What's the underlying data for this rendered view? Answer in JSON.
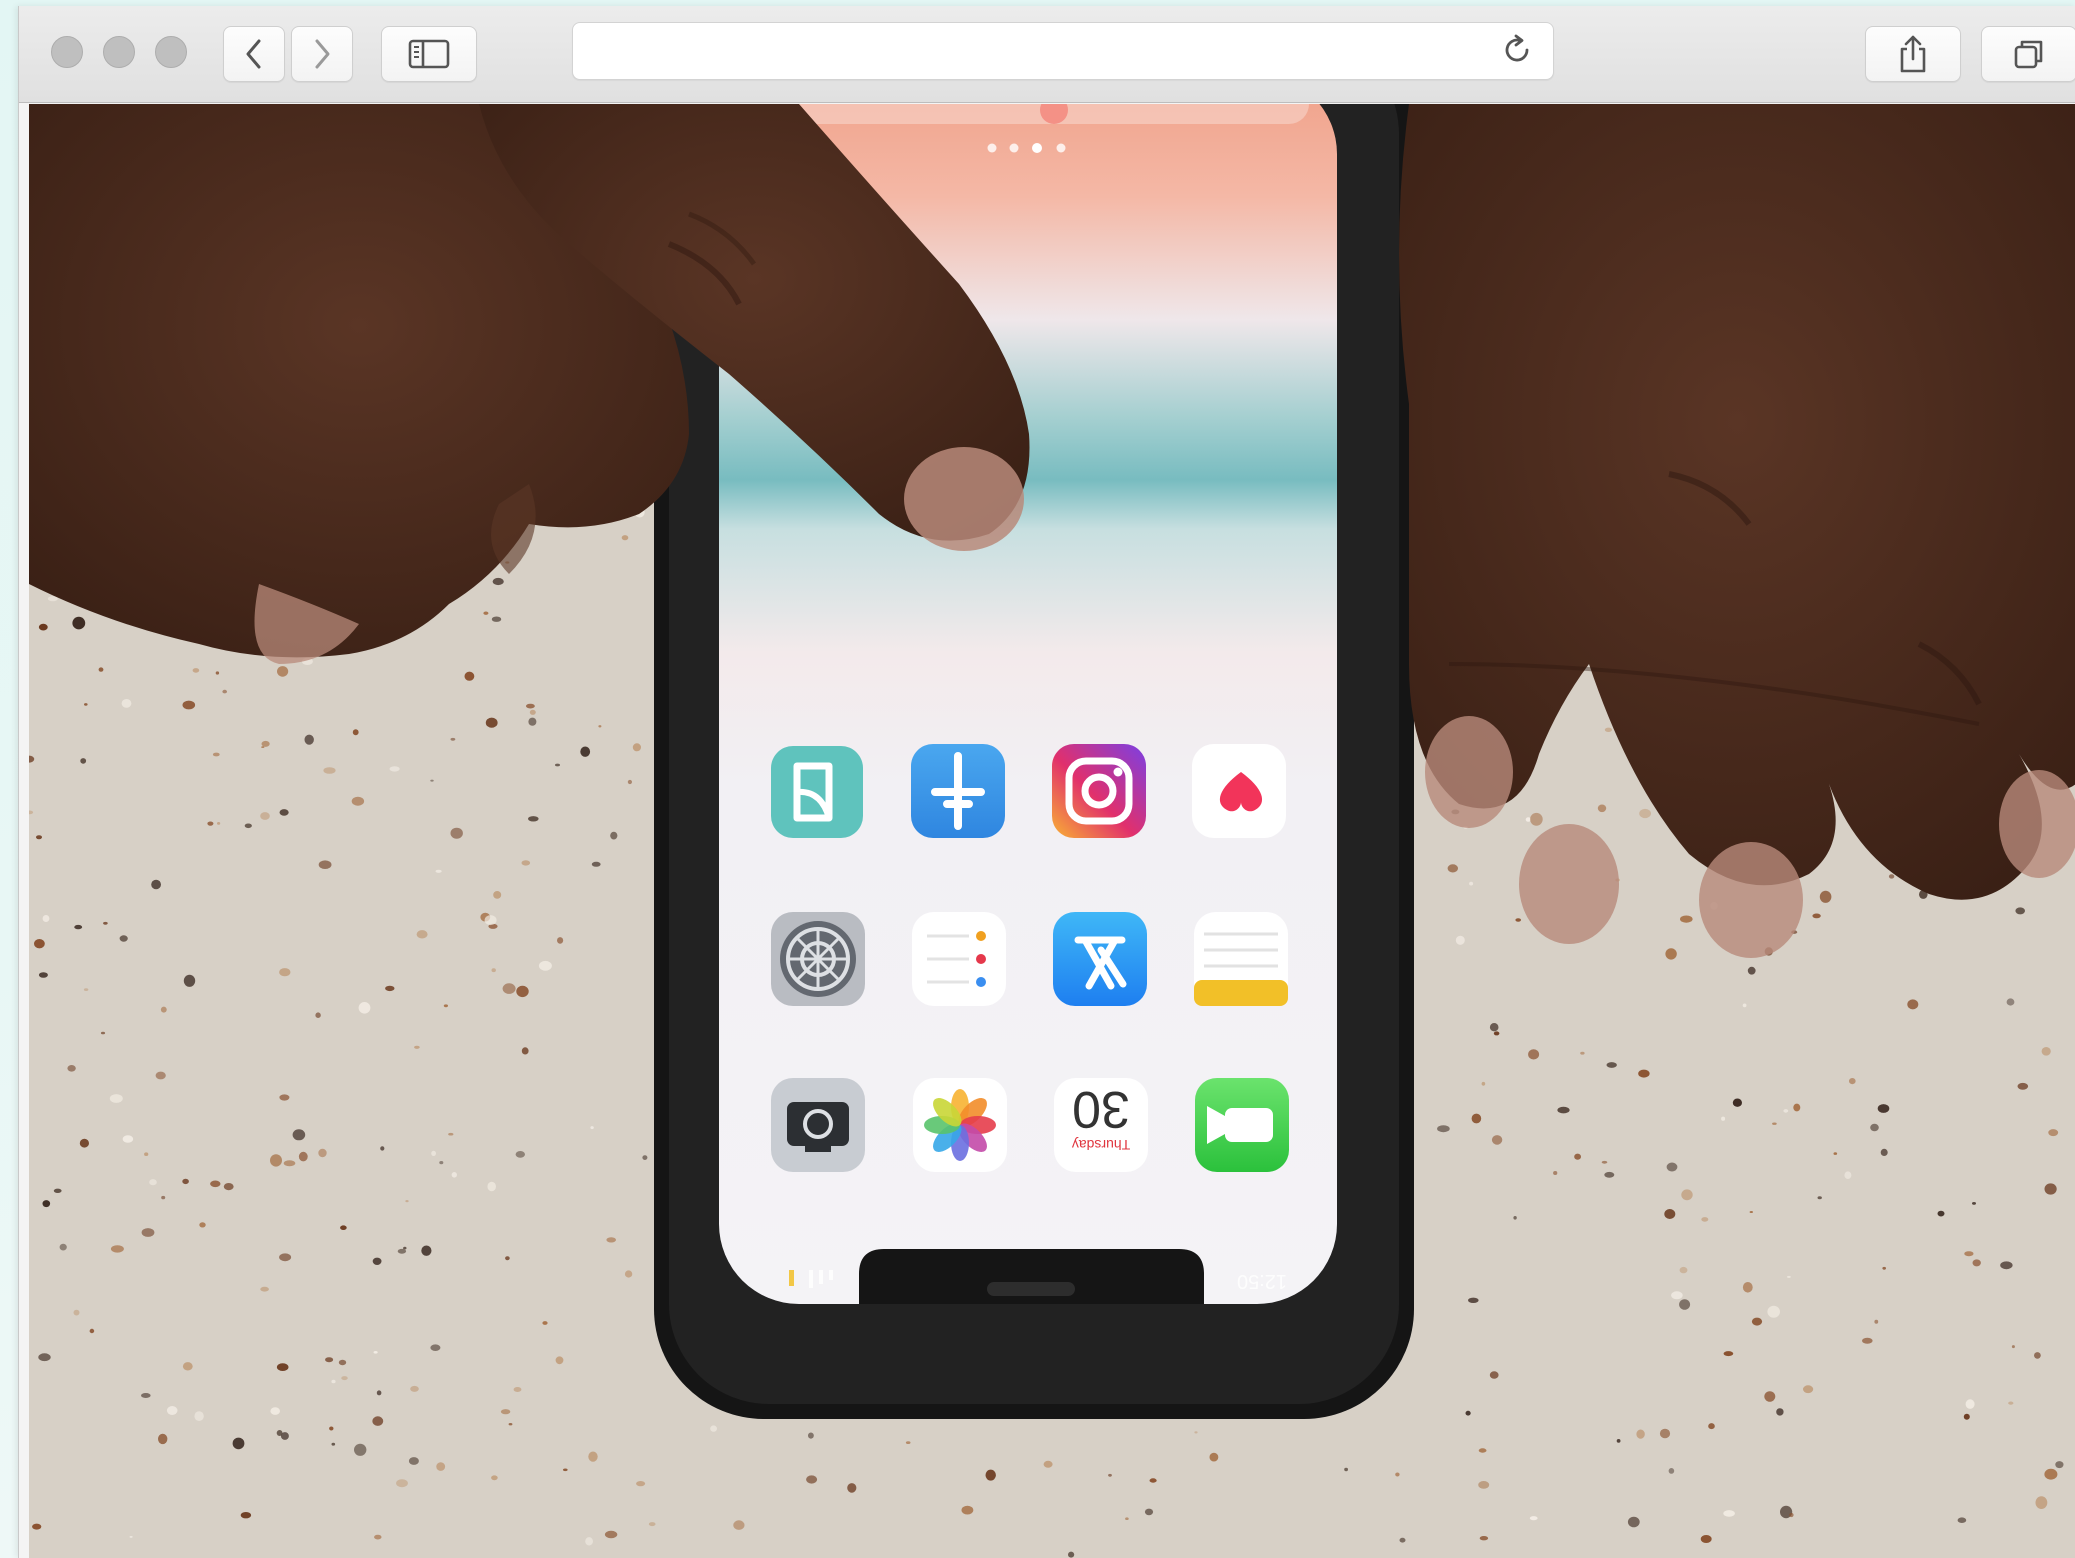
{
  "browser": {
    "address": {
      "url": ""
    },
    "toolbar": {
      "back_icon": "chevron-left-icon",
      "forward_icon": "chevron-right-icon",
      "sidebar_icon": "sidebar-icon",
      "reload_icon": "reload-icon",
      "share_icon": "share-icon",
      "tabs_icon": "tabs-overview-icon"
    },
    "window_controls": [
      "close",
      "minimize",
      "zoom"
    ]
  },
  "photo": {
    "subject": "phone-on-terrazzo",
    "phone_screen": {
      "time_label": "12:50",
      "date_day": "30",
      "date_weekday": "Thursday",
      "apps": [
        {
          "icon": "pages-icon"
        },
        {
          "icon": "testflight-icon"
        },
        {
          "icon": "instagram-icon"
        },
        {
          "icon": "health-icon"
        },
        {
          "icon": "settings-icon"
        },
        {
          "icon": "reminders-icon"
        },
        {
          "icon": "app-store-icon"
        },
        {
          "icon": "notes-icon"
        },
        {
          "icon": "camera-icon"
        },
        {
          "icon": "photos-icon"
        },
        {
          "icon": "calendar-icon"
        },
        {
          "icon": "facetime-icon"
        }
      ]
    }
  },
  "colors": {
    "toolbar_bg": "#e4e4e4",
    "backdrop": "#e5f7f5",
    "terrazzo": "#d6cfc6",
    "skin": "#4a2a1c"
  }
}
